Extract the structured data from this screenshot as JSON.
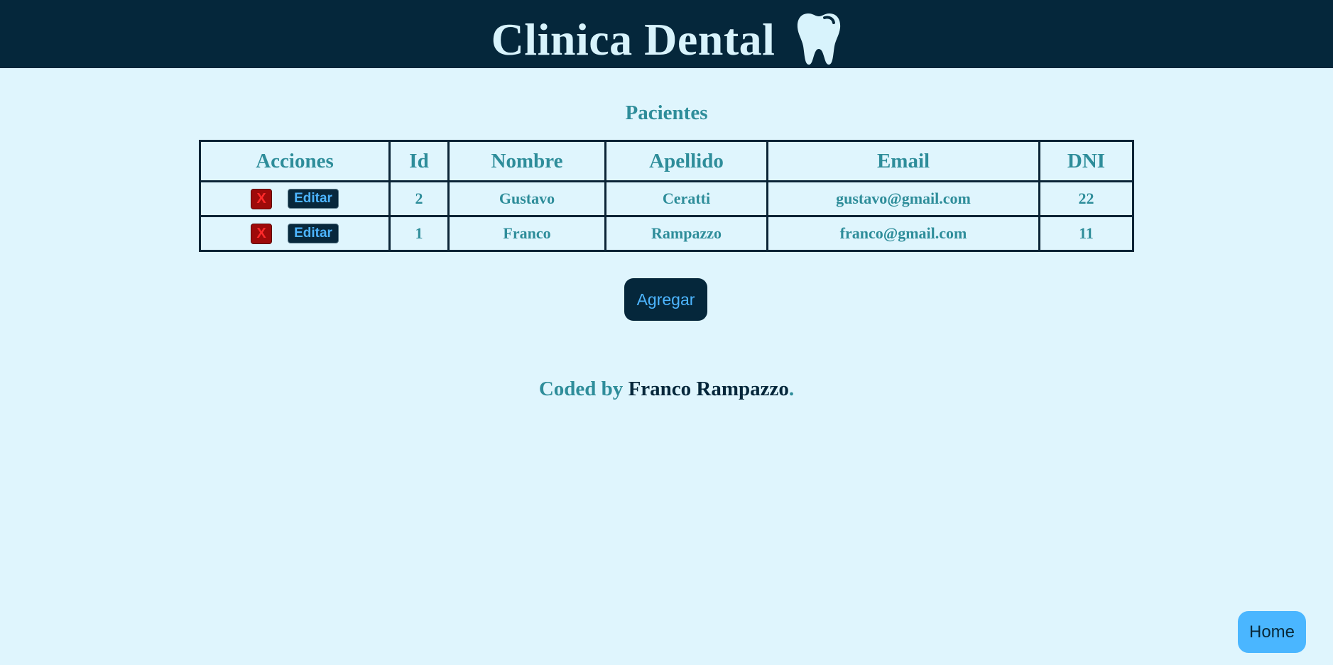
{
  "header": {
    "title": "Clinica Dental",
    "icon": "tooth-icon"
  },
  "section_title": "Pacientes",
  "table": {
    "columns": [
      "Acciones",
      "Id",
      "Nombre",
      "Apellido",
      "Email",
      "DNI"
    ],
    "rows": [
      {
        "delete_label": "X",
        "edit_label": "Editar",
        "id": "2",
        "nombre": "Gustavo",
        "apellido": "Ceratti",
        "email": "gustavo@gmail.com",
        "dni": "22"
      },
      {
        "delete_label": "X",
        "edit_label": "Editar",
        "id": "1",
        "nombre": "Franco",
        "apellido": "Rampazzo",
        "email": "franco@gmail.com",
        "dni": "11"
      }
    ]
  },
  "add_button": "Agregar",
  "footer": {
    "prefix": "Coded by ",
    "author": "Franco Rampazzo",
    "suffix": "."
  },
  "home_button": "Home",
  "colors": {
    "header_bg": "#05273b",
    "page_bg": "#dff5fd",
    "accent_text": "#2e8d9a",
    "button_text": "#4db5ff",
    "delete_bg": "#9e0a0a",
    "home_bg": "#4ab6ff"
  }
}
